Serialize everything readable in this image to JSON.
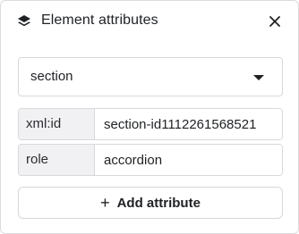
{
  "header": {
    "title": "Element attributes",
    "icon": "layers-icon",
    "close_icon": "close-icon"
  },
  "element_select": {
    "selected": "section",
    "icon": "caret-down-icon"
  },
  "attributes": [
    {
      "key": "xml:id",
      "value": "section-id1112261568521"
    },
    {
      "key": "role",
      "value": "accordion"
    }
  ],
  "add_button": {
    "icon": "plus-icon",
    "label": "Add attribute"
  }
}
